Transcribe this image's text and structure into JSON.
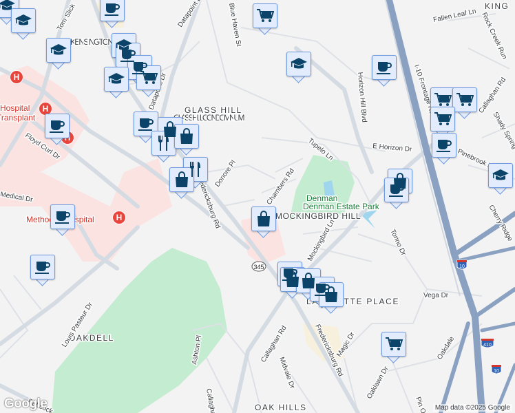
{
  "map": {
    "areas": [
      "KENSINGTON ROW",
      "GLASS HILL CONDOMINIUM",
      "MOCKINGBIRD HILL",
      "LAFAYETTE PLACE",
      "OAKDELL",
      "OAK HILLS",
      "KING"
    ],
    "parks": [
      "Denman Estate Park"
    ],
    "hospitals": [
      "Hospital",
      "Transplant",
      "Methodist Hospital",
      "Methodist Hospital (partial)"
    ],
    "streets": [
      "Tom Slick",
      "Datapoint Dr",
      "Datapoint Dr",
      "Blue Haven St",
      "Fallen Leaf Ln",
      "Rock Creek Run",
      "Horizon Hill Blvd",
      "I-10 Frontage Rd",
      "Callaghan Rd",
      "E Horizon Dr",
      "Pinebrook Dr",
      "Shady Spring",
      "Tupelo Ln",
      "Chambers Rd",
      "Floyd Curl Dr",
      "Medical Dr",
      "Fredericksburg Rd",
      "Donore Pl",
      "Cherry Ridge",
      "Torino Dr",
      "Vega Dr",
      "Mockingbird Ln",
      "Louis Pasteur Dr",
      "Callaghan Rd",
      "Midvale Dr",
      "Magic Dr",
      "Fredericksburg Rd",
      "Oaklawn Dr",
      "Oakdale",
      "Ashton Pl",
      "Callaghan Rd",
      "Pin Oak",
      "Babcock"
    ],
    "shields": [
      "345",
      "10",
      "410",
      "10"
    ],
    "markers": [
      "education",
      "education",
      "coffee",
      "education",
      "education",
      "coffee",
      "coffee",
      "education",
      "grocery",
      "coffee",
      "coffee",
      "shopping",
      "restaurant",
      "shopping",
      "restaurant",
      "shopping",
      "grocery",
      "education",
      "coffee",
      "grocery",
      "grocery",
      "grocery",
      "coffee",
      "education",
      "shopping",
      "coffee",
      "coffee",
      "coffee",
      "shopping",
      "coffee",
      "shopping",
      "shopping",
      "coffee",
      "shopping",
      "grocery"
    ],
    "hospital_marker": "H"
  },
  "attribution": "Map data ©2025 Google",
  "logo": "Google",
  "colors": {
    "marker_fill": "#e3ecfc",
    "marker_icon": "#0b4468",
    "hospital": "#e8453c",
    "park": "#bfe8cc",
    "highway": "#8aa1c1"
  }
}
